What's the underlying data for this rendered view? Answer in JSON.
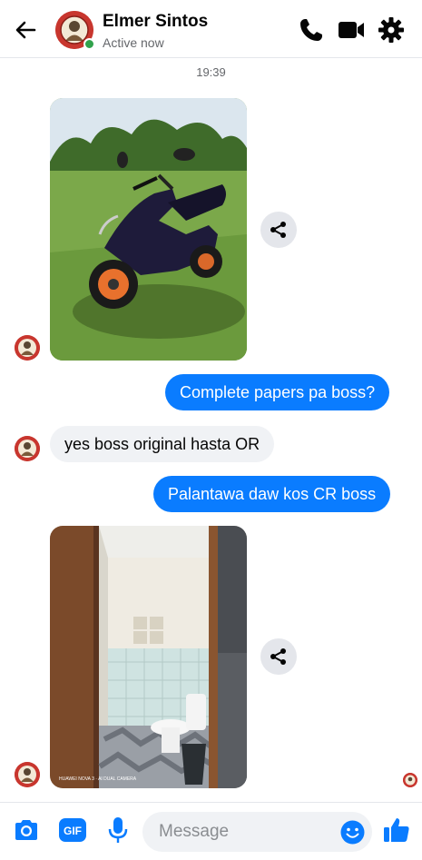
{
  "header": {
    "contact_name": "Elmer Sintos",
    "status": "Active now"
  },
  "conversation": {
    "timestamp": "19:39",
    "messages": [
      {
        "from": "them",
        "type": "photo",
        "alt": "motor scooter"
      },
      {
        "from": "me",
        "type": "text",
        "text": "Complete papers pa boss?"
      },
      {
        "from": "them",
        "type": "text",
        "text": "yes boss original hasta OR"
      },
      {
        "from": "me",
        "type": "text",
        "text": "Palantawa daw kos CR boss"
      },
      {
        "from": "them",
        "type": "photo",
        "alt": "bathroom",
        "watermark": "HUAWEI NOVA 3 · AI DUAL CAMERA"
      }
    ]
  },
  "composer": {
    "placeholder": "Message",
    "gif_label": "GIF"
  },
  "colors": {
    "accent": "#0a7cff",
    "incoming_bubble": "#f0f2f5",
    "icon": "#0a7cff",
    "active": "#31a24c"
  },
  "icons": [
    "back-arrow-icon",
    "phone-icon",
    "video-camera-icon",
    "gear-icon",
    "share-icon",
    "camera-icon",
    "gif-icon",
    "microphone-icon",
    "emoji-icon",
    "thumbs-up-icon"
  ]
}
